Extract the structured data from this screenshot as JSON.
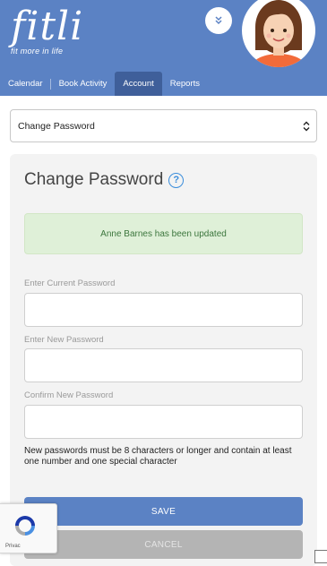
{
  "app": {
    "logo_text": "fitli",
    "tagline": "fit more in life"
  },
  "nav": {
    "items": [
      {
        "label": "Calendar",
        "active": false
      },
      {
        "label": "Book Activity",
        "active": false
      },
      {
        "label": "Account",
        "active": true
      },
      {
        "label": "Reports",
        "active": false
      }
    ]
  },
  "account_select": {
    "selected": "Change Password"
  },
  "form": {
    "title": "Change Password",
    "alert": "Anne Barnes has been updated",
    "fields": [
      {
        "label": "Enter Current Password",
        "value": ""
      },
      {
        "label": "Enter New Password",
        "value": ""
      },
      {
        "label": "Confirm New Password",
        "value": ""
      }
    ],
    "help_text": "New passwords must be 8 characters or longer and contain at least one number and one special character",
    "save_label": "SAVE",
    "cancel_label": "CANCEL"
  },
  "recaptcha": {
    "text": "Privac"
  },
  "colors": {
    "brand": "#5b82c4",
    "nav_active": "#3f5f9a",
    "success_bg": "#dff0d8",
    "success_text": "#3c763d",
    "help_icon": "#3a8ddb"
  },
  "icons": {
    "expand": "chevrons-down-icon",
    "help": "question-circle-icon",
    "select": "select-arrows-icon"
  }
}
